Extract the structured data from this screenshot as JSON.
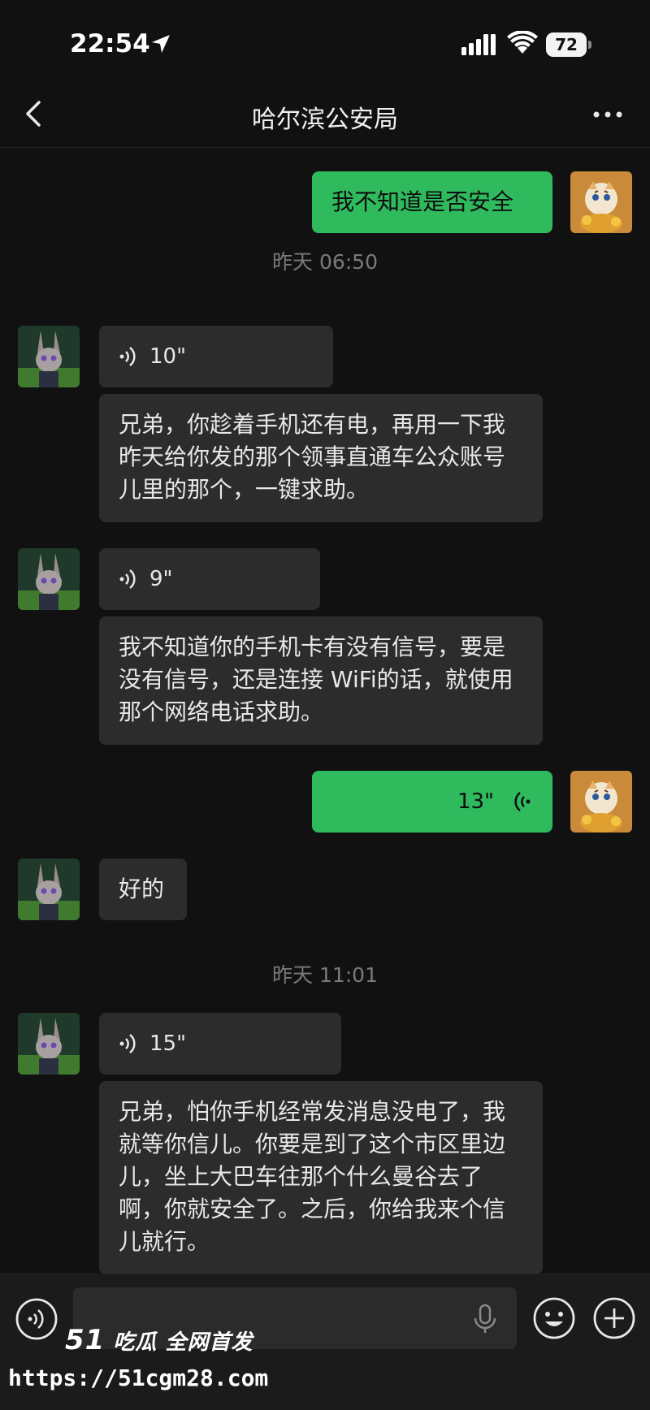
{
  "status_bar": {
    "time": "22:54",
    "battery": "72"
  },
  "nav": {
    "title": "哈尔滨公安局"
  },
  "messages": {
    "m1": {
      "text": "我不知道是否安全"
    },
    "ts1": "昨天 06:50",
    "m2": {
      "duration": "10\""
    },
    "m3": {
      "text": "兄弟，你趁着手机还有电，再用一下我昨天给你发的那个领事直通车公众账号儿里的那个，一键求助。"
    },
    "m4": {
      "duration": "9\""
    },
    "m5": {
      "text": "我不知道你的手机卡有没有信号，要是没有信号，还是连接 WiFi的话，就使用那个网络电话求助。"
    },
    "m6": {
      "duration": "13\""
    },
    "m7": {
      "text": "好的"
    },
    "ts2": "昨天 11:01",
    "m8": {
      "duration": "15\""
    },
    "m9": {
      "text": "兄弟，怕你手机经常发消息没电了，我就等你信儿。你要是到了这个市区里边儿，坐上大巴车往那个什么曼谷去了啊，你就安全了。之后，你给我来个信儿就行。"
    }
  },
  "watermark": {
    "logo_num": "51",
    "logo_text": "吃瓜 全网首发",
    "url": "https://51cgm28.com"
  },
  "colors": {
    "background": "#111111",
    "bubble_in": "#2c2c2c",
    "bubble_out": "#2fba5e",
    "timestamp": "#7a7a7a"
  },
  "icons": {
    "back": "chevron-left-icon",
    "more": "more-dots-icon",
    "voice_mode": "voice-mode-icon",
    "mic": "microphone-icon",
    "emoji": "emoji-icon",
    "plus": "plus-icon"
  }
}
